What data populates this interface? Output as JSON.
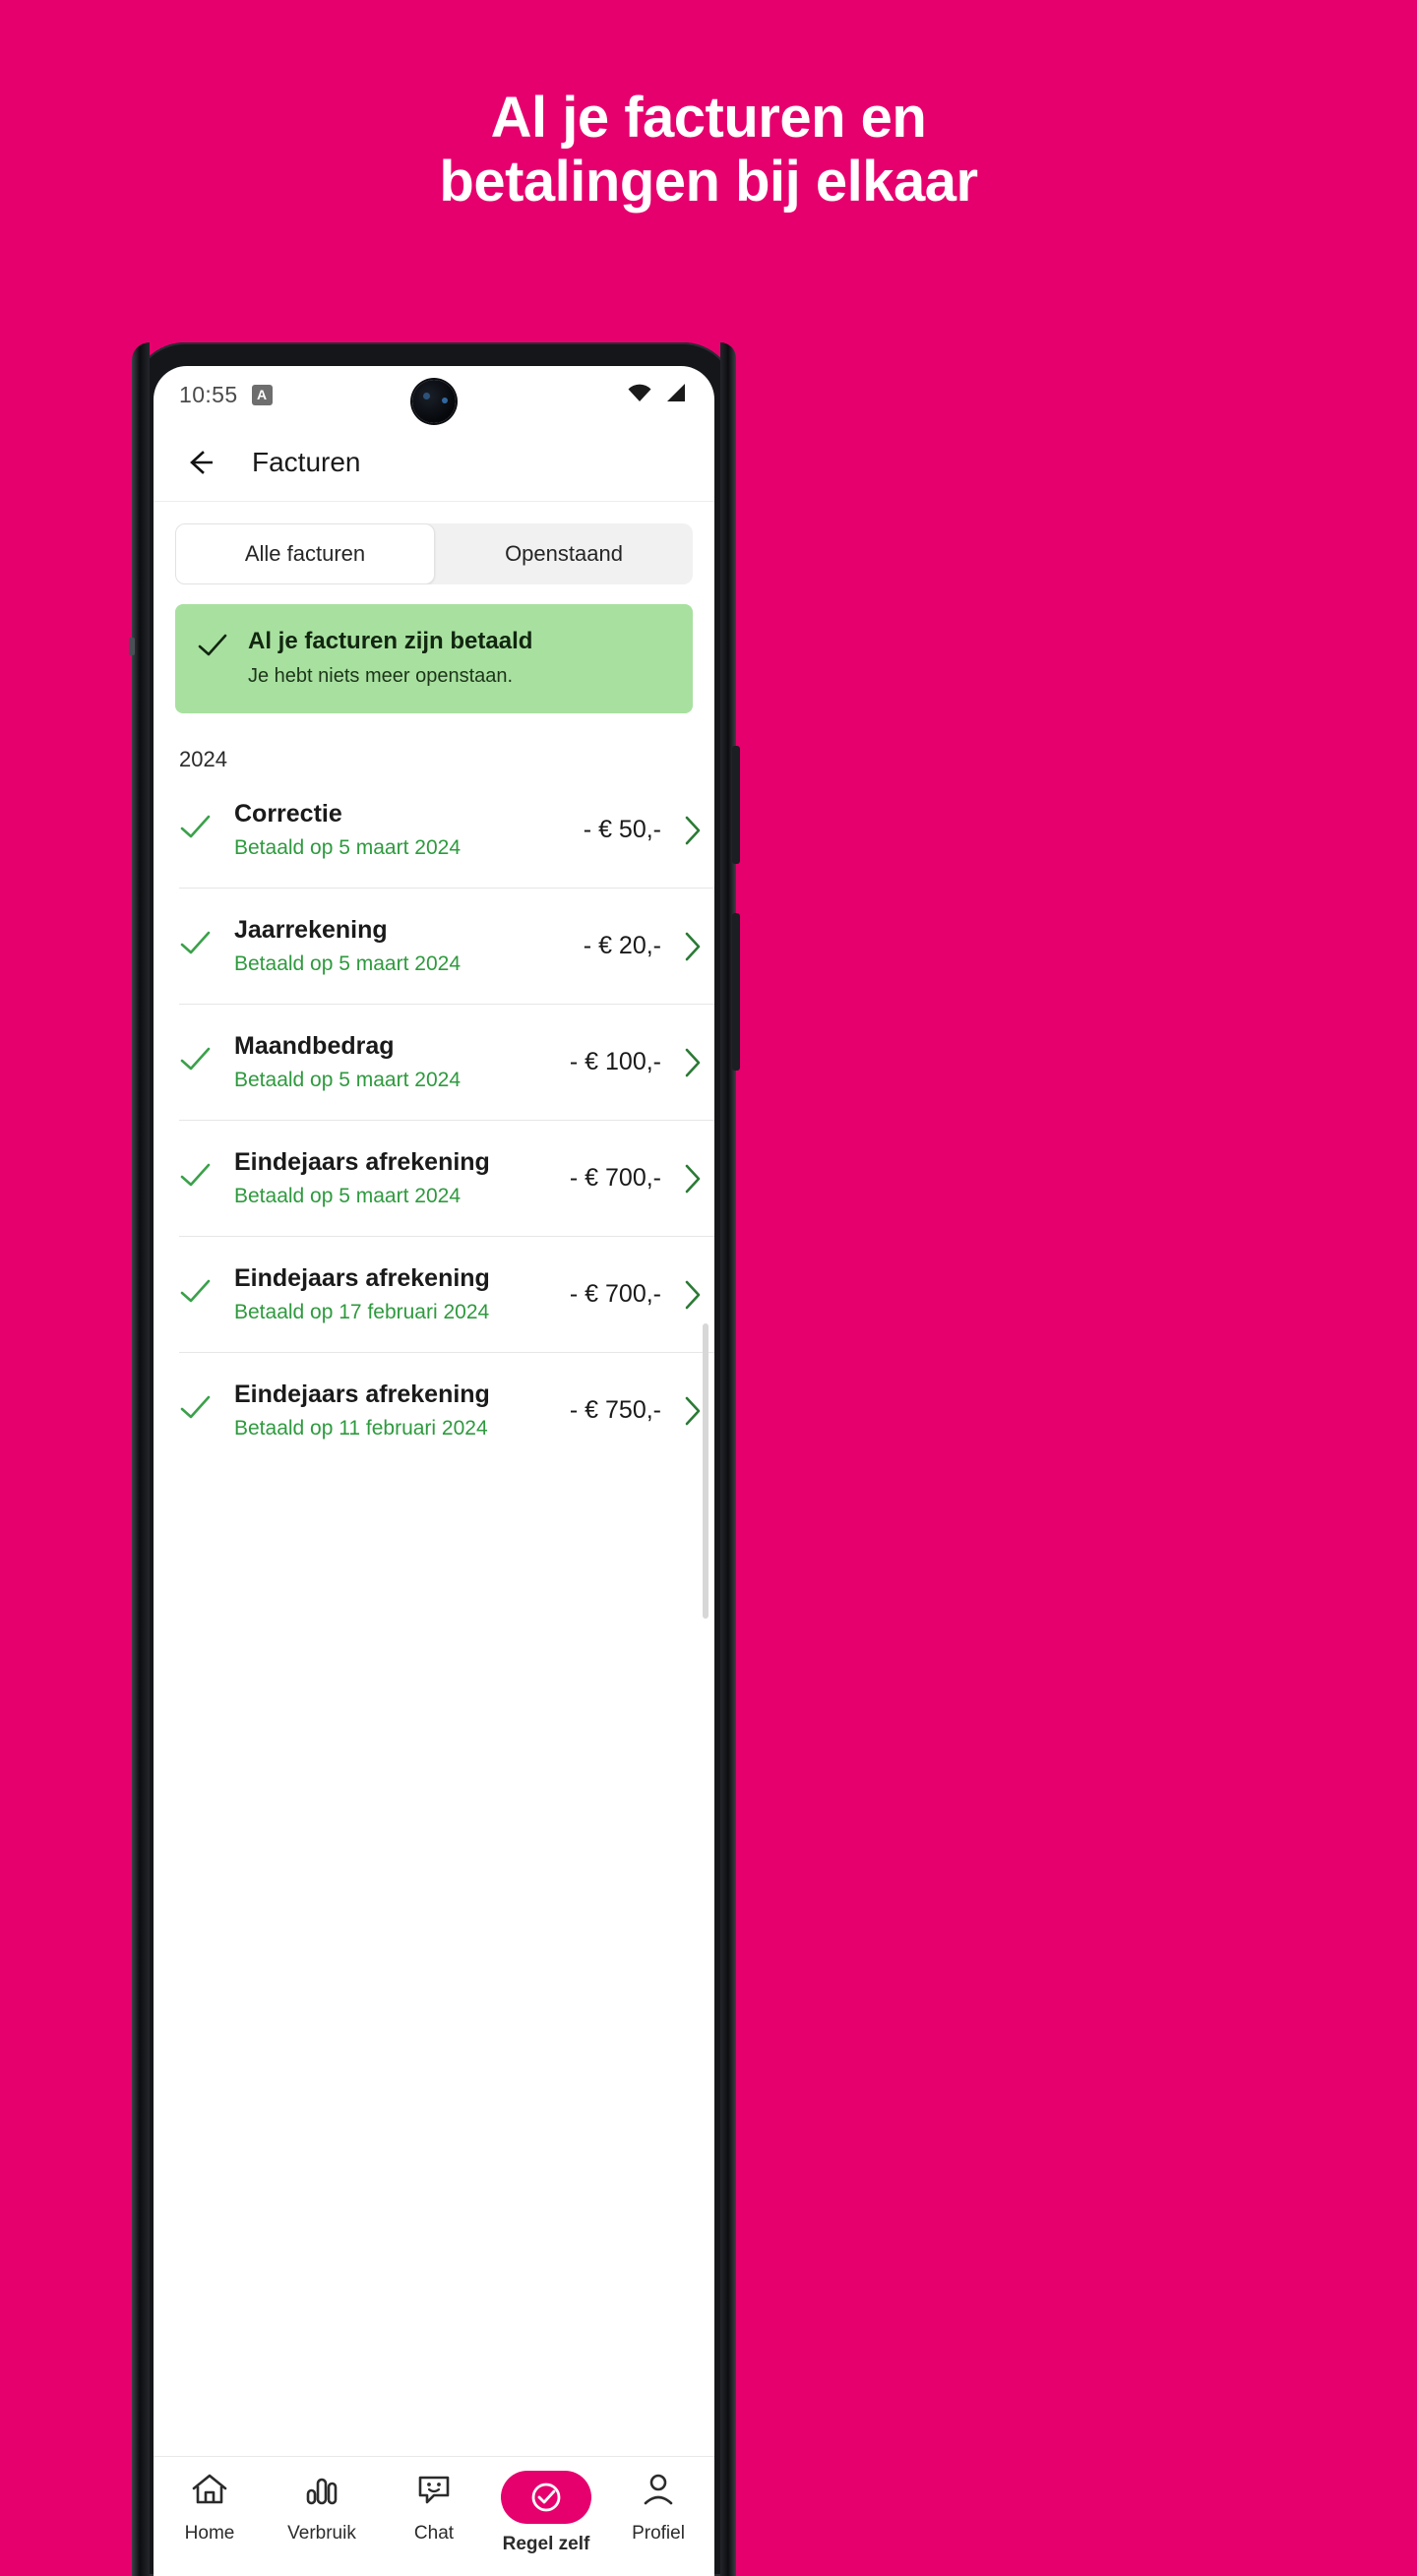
{
  "promo": {
    "headline_line1": "Al je facturen en",
    "headline_line2": "betalingen bij elkaar",
    "background_color": "#E6006E"
  },
  "statusbar": {
    "time": "10:55",
    "app_badge": "A",
    "icons": [
      "wifi-icon",
      "signal-icon"
    ]
  },
  "appbar": {
    "back_icon": "arrow-left-icon",
    "title": "Facturen"
  },
  "tabs": [
    {
      "label": "Alle facturen",
      "active": true
    },
    {
      "label": "Openstaand",
      "active": false
    }
  ],
  "banner": {
    "icon": "check-icon",
    "title": "Al je facturen zijn betaald",
    "subtitle": "Je hebt niets meer openstaan.",
    "background_color": "#A8E0A0"
  },
  "year_label": "2024",
  "invoices": [
    {
      "title": "Correctie",
      "status": "Betaald op 5 maart 2024",
      "amount": "- € 50,-"
    },
    {
      "title": "Jaarrekening",
      "status": "Betaald op 5 maart 2024",
      "amount": "- € 20,-"
    },
    {
      "title": "Maandbedrag",
      "status": "Betaald op 5 maart 2024",
      "amount": "- € 100,-"
    },
    {
      "title": "Eindejaars afrekening",
      "status": "Betaald op 5 maart 2024",
      "amount": "- € 700,-"
    },
    {
      "title": "Eindejaars afrekening",
      "status": "Betaald op 17 februari 2024",
      "amount": "- € 700,-"
    },
    {
      "title": "Eindejaars afrekening",
      "status": "Betaald op 11 februari 2024",
      "amount": "- € 750,-"
    }
  ],
  "bottom_nav": [
    {
      "label": "Home",
      "icon": "home-icon",
      "active": false
    },
    {
      "label": "Verbruik",
      "icon": "bar-chart-icon",
      "active": false
    },
    {
      "label": "Chat",
      "icon": "chat-smiley-icon",
      "active": false
    },
    {
      "label": "Regel zelf",
      "icon": "check-circle-icon",
      "active": true
    },
    {
      "label": "Profiel",
      "icon": "person-icon",
      "active": false
    }
  ],
  "colors": {
    "brand_pink": "#E6006E",
    "paid_green": "#2E9A3E",
    "banner_green": "#A8E0A0"
  }
}
